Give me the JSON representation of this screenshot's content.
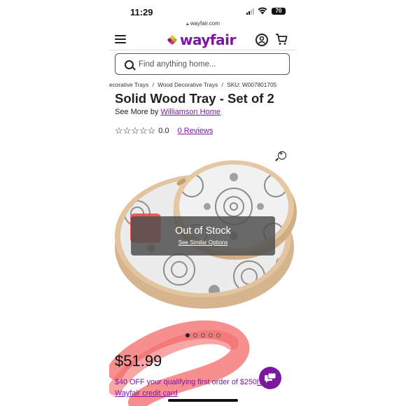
{
  "status_bar": {
    "time": "11:29",
    "battery": "70"
  },
  "browser": {
    "url": "wayfair.com"
  },
  "header": {
    "logo_text": "wayfair"
  },
  "search": {
    "placeholder": "Find anything home..."
  },
  "breadcrumb": {
    "items": [
      "ecorative Trays",
      "Wood Decorative Trays"
    ],
    "separator": "/",
    "sku": "SKU: W007801705"
  },
  "product": {
    "title": "Solid Wood Tray - Set of 2",
    "see_more_prefix": "See More by",
    "brand": "Williamson Home",
    "rating_value": "0.0",
    "reviews_link": "0 Reviews",
    "stars_filled": 0,
    "stars_total": 5
  },
  "image": {
    "overlay_title": "Out of Stock",
    "overlay_link": "See Similar Options",
    "carousel_count": 5,
    "carousel_active": 0
  },
  "pricing": {
    "price": "$51.99",
    "promo_prefix": "$40 OFF your qualifying first order of $250",
    "promo_link_1": "h a",
    "promo_link_2": "Wayfair credit card"
  },
  "colors": {
    "brand_purple": "#7b189f",
    "overlay": "#505050",
    "scribble": "#f46a6a"
  },
  "icons": [
    "menu-icon",
    "account-icon",
    "cart-icon",
    "search-icon",
    "zoom-icon",
    "star-icon",
    "chat-icon",
    "lock-icon"
  ]
}
